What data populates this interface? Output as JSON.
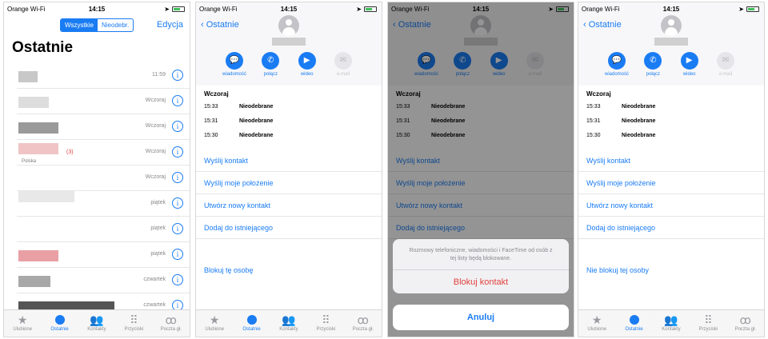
{
  "status": {
    "carrier": "Orange Wi-Fi",
    "time": "14:15"
  },
  "recents_screen": {
    "seg_all": "Wszystkie",
    "seg_missed": "Nieodebr.",
    "edit": "Edycja",
    "title": "Ostatnie",
    "rows": [
      {
        "when": "11:59",
        "missed": "",
        "sub": ""
      },
      {
        "when": "Wczoraj",
        "missed": "",
        "sub": ""
      },
      {
        "when": "Wczoraj",
        "missed": "",
        "sub": ""
      },
      {
        "when": "Wczoraj",
        "missed": "(3)",
        "sub": "Polska"
      },
      {
        "when": "Wczoraj",
        "missed": "",
        "sub": ""
      },
      {
        "when": "piątek",
        "missed": "",
        "sub": ""
      },
      {
        "when": "piątek",
        "missed": "",
        "sub": ""
      },
      {
        "when": "piątek",
        "missed": "",
        "sub": ""
      },
      {
        "when": "czwartek",
        "missed": "",
        "sub": ""
      },
      {
        "when": "czwartek",
        "missed": "",
        "sub": ""
      }
    ],
    "info_glyph": "i"
  },
  "tabs": [
    {
      "label": "Ulubione",
      "icon": "star-icon"
    },
    {
      "label": "Ostatnie",
      "icon": "clock-icon"
    },
    {
      "label": "Kontakty",
      "icon": "contacts-icon"
    },
    {
      "label": "Przyciski",
      "icon": "keypad-icon"
    },
    {
      "label": "Poczta gł.",
      "icon": "voicemail-icon"
    }
  ],
  "contact": {
    "back": "Ostatnie",
    "actions": [
      "wiadomość",
      "połącz",
      "wideo",
      "e-mail"
    ],
    "day": "Wczoraj",
    "calls": [
      {
        "time": "15:33",
        "status": "Nieodebrane"
      },
      {
        "time": "15:31",
        "status": "Nieodebrane"
      },
      {
        "time": "15:30",
        "status": "Nieodebrane"
      }
    ],
    "options": [
      "Wyślij kontakt",
      "Wyślij moje położenie",
      "Utwórz nowy kontakt",
      "Dodaj do istniejącego"
    ],
    "block": "Blokuj tę osobę",
    "unblock": "Nie blokuj tej osoby"
  },
  "sheet": {
    "message": "Rozmowy telefoniczne, wiadomości i FaceTime od osób z tej listy będą blokowane.",
    "block_button": "Blokuj kontakt",
    "cancel": "Anuluj"
  },
  "colors": {
    "accent": "#1a7cf3",
    "destructive": "#e0413f"
  }
}
